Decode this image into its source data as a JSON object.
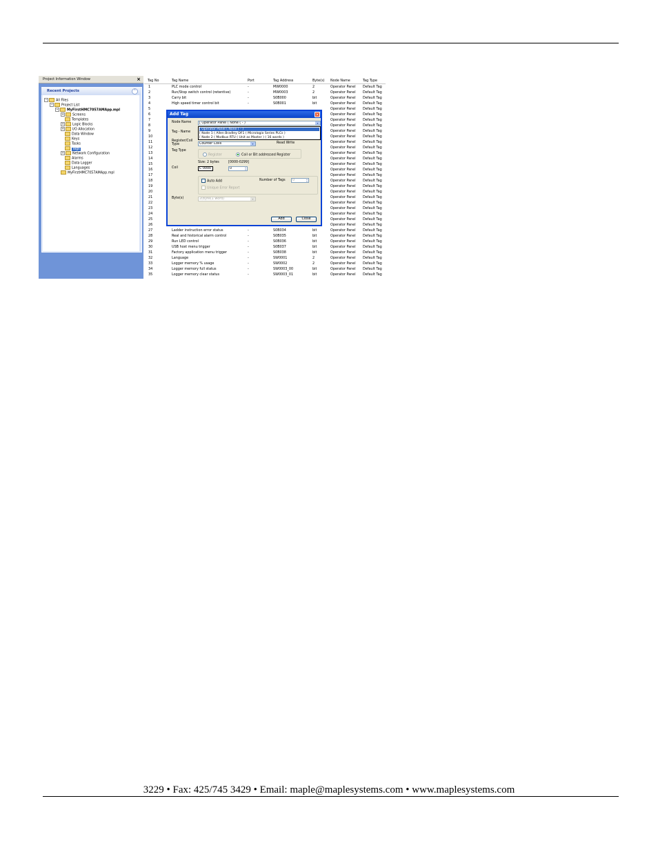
{
  "footer": {
    "text": "3229  • Fax: 425/745 3429 • Email: maple@maplesystems.com • www.maplesystems.com"
  },
  "project_window": {
    "title": "Project Information Window",
    "close": "×",
    "recent_projects": "Recent Projects",
    "tree": {
      "all_files": "All Files",
      "project_list": "Project List",
      "project": "MyFirstHMC7057AMApp.mpl",
      "items": [
        "Screens",
        "Templates",
        "Logic Blocks",
        "I/O Allocation",
        "Data Window",
        "Keys",
        "Tasks",
        "Tags",
        "Network Configuration",
        "Alarms",
        "Data Logger",
        "Languages"
      ],
      "recent_file": "MyFirstHMC7057AMApp.mpl"
    }
  },
  "tag_table": {
    "headers": [
      "Tag No",
      "Tag Name",
      "Port",
      "Tag Address",
      "Byte(s)",
      "Node Name",
      "Tag Type"
    ],
    "rows": [
      [
        "1",
        "PLC mode control",
        "-",
        "MW0000",
        "2",
        "Operator Panel",
        "Default Tag"
      ],
      [
        "2",
        "Run/Stop switch control (retentive)",
        "-",
        "MW0003",
        "2",
        "Operator Panel",
        "Default Tag"
      ],
      [
        "3",
        "Carry bit",
        "-",
        "S0B000",
        "bit",
        "Operator Panel",
        "Default Tag"
      ],
      [
        "4",
        "High speed timer control bit",
        "-",
        "S0B001",
        "bit",
        "Operator Panel",
        "Default Tag"
      ],
      [
        "5",
        "",
        "",
        "",
        "",
        "Operator Panel",
        "Default Tag"
      ],
      [
        "6",
        "",
        "",
        "",
        "",
        "Operator Panel",
        "Default Tag"
      ],
      [
        "7",
        "",
        "",
        "",
        "",
        "Operator Panel",
        "Default Tag"
      ],
      [
        "8",
        "",
        "",
        "",
        "",
        "Operator Panel",
        "Default Tag"
      ],
      [
        "9",
        "",
        "",
        "",
        "",
        "Operator Panel",
        "Default Tag"
      ],
      [
        "10",
        "",
        "",
        "",
        "",
        "Operator Panel",
        "Default Tag"
      ],
      [
        "11",
        "",
        "",
        "",
        "",
        "Operator Panel",
        "Default Tag"
      ],
      [
        "12",
        "",
        "",
        "",
        "",
        "Operator Panel",
        "Default Tag"
      ],
      [
        "13",
        "",
        "",
        "",
        "",
        "Operator Panel",
        "Default Tag"
      ],
      [
        "14",
        "",
        "",
        "",
        "",
        "Operator Panel",
        "Default Tag"
      ],
      [
        "15",
        "",
        "",
        "",
        "",
        "Operator Panel",
        "Default Tag"
      ],
      [
        "16",
        "",
        "",
        "",
        "",
        "Operator Panel",
        "Default Tag"
      ],
      [
        "17",
        "",
        "",
        "",
        "",
        "Operator Panel",
        "Default Tag"
      ],
      [
        "18",
        "",
        "",
        "",
        "",
        "Operator Panel",
        "Default Tag"
      ],
      [
        "19",
        "",
        "",
        "",
        "",
        "Operator Panel",
        "Default Tag"
      ],
      [
        "20",
        "",
        "",
        "",
        "",
        "Operator Panel",
        "Default Tag"
      ],
      [
        "21",
        "",
        "",
        "",
        "",
        "Operator Panel",
        "Default Tag"
      ],
      [
        "22",
        "",
        "",
        "",
        "",
        "Operator Panel",
        "Default Tag"
      ],
      [
        "23",
        "",
        "",
        "",
        "",
        "Operator Panel",
        "Default Tag"
      ],
      [
        "24",
        "",
        "",
        "",
        "",
        "Operator Panel",
        "Default Tag"
      ],
      [
        "25",
        "",
        "",
        "",
        "",
        "Operator Panel",
        "Default Tag"
      ],
      [
        "26",
        "Data entry key selection",
        "-",
        "S0B033",
        "bit",
        "Operator Panel",
        "Default Tag"
      ],
      [
        "27",
        "Ladder instruction error status",
        "-",
        "S0B034",
        "bit",
        "Operator Panel",
        "Default Tag"
      ],
      [
        "28",
        "Real and historical alarm control",
        "-",
        "S0B035",
        "bit",
        "Operator Panel",
        "Default Tag"
      ],
      [
        "29",
        "Run LED control",
        "-",
        "S0B036",
        "bit",
        "Operator Panel",
        "Default Tag"
      ],
      [
        "30",
        "USB host menu trigger",
        "-",
        "S0B037",
        "bit",
        "Operator Panel",
        "Default Tag"
      ],
      [
        "31",
        "Factory application menu trigger",
        "-",
        "S0B038",
        "bit",
        "Operator Panel",
        "Default Tag"
      ],
      [
        "32",
        "Language",
        "-",
        "SW0001",
        "2",
        "Operator Panel",
        "Default Tag"
      ],
      [
        "33",
        "Logger memory % usage",
        "-",
        "SW0002",
        "2",
        "Operator Panel",
        "Default Tag"
      ],
      [
        "34",
        "Logger memory full status",
        "-",
        "SW0003_00",
        "bit",
        "Operator Panel",
        "Default Tag"
      ],
      [
        "35",
        "Logger memory clear status",
        "-",
        "SW0003_01",
        "bit",
        "Operator Panel",
        "Default Tag"
      ]
    ]
  },
  "add_tag_dialog": {
    "title": "Add Tag",
    "close": "×",
    "node_name_label": "Node Name",
    "node_name_value": "[ Operator Panel ( None ( - )",
    "node_options": [
      "[ Operator Panel ( None ( - )",
      "[ Node 1 ( Allen Bradley DF1 ( Micrologix Series PLCs )",
      "[ Node 2 ( Modbus RTU ( Unit as Master ) ( 16 words )"
    ],
    "tag_name_label": "Tag - Name",
    "register_coil_type_label": "Register/Coil Type",
    "register_coil_type_value": "Counter Coils",
    "read_write": "Read Write",
    "tag_type_label": "Tag Type",
    "register_option": "Register",
    "coil_option": "Coil or Bit addressed Register",
    "size_text": "Size: 2 bytes",
    "range_text": "[0000-0299]",
    "coil_label": "Coil",
    "coil_prefix": "C 0000",
    "coil_value": "0",
    "auto_add": "Auto Add",
    "number_of_tags_label": "Number of Tags",
    "number_of_tags_value": "0",
    "unique_error_report": "Unique Error Report",
    "bytes_label": "Byte(s)",
    "bytes_value": "2(Byte(1 word)",
    "add_button": "Add",
    "close_button": "Close"
  }
}
